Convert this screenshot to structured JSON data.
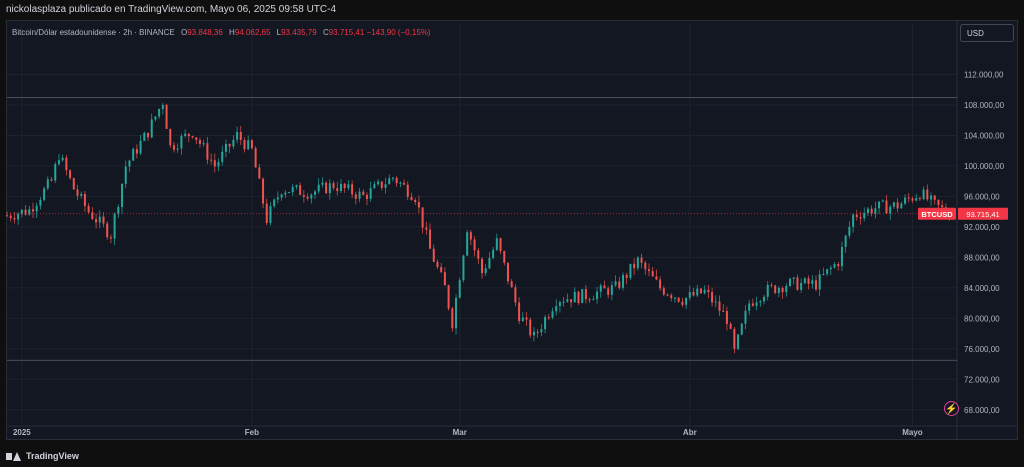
{
  "header": {
    "published": "nickolasplaza publicado en TradingView.com, Mayo 06, 2025 09:58 UTC-4"
  },
  "legend": {
    "title": "Bitcoin/Dólar estadounidense · 2h · BINANCE",
    "o_key": "O",
    "open": "93.848,36",
    "h_key": "H",
    "high": "94.062,65",
    "l_key": "L",
    "low": "93.435,79",
    "c_key": "C",
    "close": "93.715,41",
    "change": "−143,90 (−0,15%)"
  },
  "currency_button": "USD",
  "price_tag": {
    "symbol": "BTCUSD",
    "value": "93.715,41"
  },
  "footer": {
    "brand": "TradingView"
  },
  "colors": {
    "up": "#26a69a",
    "down": "#ef5350",
    "tag": "#f23645",
    "flash": "#e040a0"
  },
  "chart_data": {
    "type": "candlestick",
    "symbol": "BTCUSD",
    "interval": "2h",
    "exchange": "BINANCE",
    "ylim": [
      66000,
      116000
    ],
    "y_ticks": [
      "112.000,00",
      "108.000,00",
      "104.000,00",
      "100.000,00",
      "96.000,00",
      "92.000,00",
      "88.000,00",
      "84.000,00",
      "80.000,00",
      "76.000,00",
      "72.000,00",
      "68.000,00"
    ],
    "y_tick_values": [
      112000,
      108000,
      104000,
      100000,
      96000,
      92000,
      88000,
      84000,
      80000,
      76000,
      72000,
      68000
    ],
    "x_ticks": [
      "2025",
      "Feb",
      "Mar",
      "Abr",
      "Mayo"
    ],
    "x_tick_dates": [
      "2025-01-01",
      "2025-02-01",
      "2025-03-01",
      "2025-04-01",
      "2025-05-01"
    ],
    "x_range": [
      "2024-12-30",
      "2025-05-07"
    ],
    "last_price": 93715.41,
    "hlines": [
      109000,
      74500
    ],
    "closes": [
      {
        "date": "2024-12-30",
        "close": 93500
      },
      {
        "date": "2025-01-02",
        "close": 94200
      },
      {
        "date": "2025-01-05",
        "close": 98000
      },
      {
        "date": "2025-01-06",
        "close": 101500
      },
      {
        "date": "2025-01-08",
        "close": 97000
      },
      {
        "date": "2025-01-10",
        "close": 94000
      },
      {
        "date": "2025-01-13",
        "close": 91000
      },
      {
        "date": "2025-01-15",
        "close": 100000
      },
      {
        "date": "2025-01-18",
        "close": 104500
      },
      {
        "date": "2025-01-20",
        "close": 108500
      },
      {
        "date": "2025-01-21",
        "close": 102500
      },
      {
        "date": "2025-01-24",
        "close": 104500
      },
      {
        "date": "2025-01-27",
        "close": 100000
      },
      {
        "date": "2025-01-30",
        "close": 104000
      },
      {
        "date": "2025-02-01",
        "close": 102000
      },
      {
        "date": "2025-02-03",
        "close": 93000
      },
      {
        "date": "2025-02-05",
        "close": 97000
      },
      {
        "date": "2025-02-09",
        "close": 96500
      },
      {
        "date": "2025-02-12",
        "close": 97500
      },
      {
        "date": "2025-02-16",
        "close": 96000
      },
      {
        "date": "2025-02-20",
        "close": 98500
      },
      {
        "date": "2025-02-23",
        "close": 96000
      },
      {
        "date": "2025-02-25",
        "close": 89000
      },
      {
        "date": "2025-02-27",
        "close": 84000
      },
      {
        "date": "2025-02-28",
        "close": 79500
      },
      {
        "date": "2025-03-02",
        "close": 92000
      },
      {
        "date": "2025-03-04",
        "close": 86000
      },
      {
        "date": "2025-03-06",
        "close": 90000
      },
      {
        "date": "2025-03-09",
        "close": 80500
      },
      {
        "date": "2025-03-11",
        "close": 77500
      },
      {
        "date": "2025-03-14",
        "close": 82500
      },
      {
        "date": "2025-03-18",
        "close": 83000
      },
      {
        "date": "2025-03-22",
        "close": 84000
      },
      {
        "date": "2025-03-25",
        "close": 87500
      },
      {
        "date": "2025-03-28",
        "close": 84000
      },
      {
        "date": "2025-03-31",
        "close": 82500
      },
      {
        "date": "2025-04-03",
        "close": 83500
      },
      {
        "date": "2025-04-06",
        "close": 80000
      },
      {
        "date": "2025-04-07",
        "close": 75500
      },
      {
        "date": "2025-04-09",
        "close": 82000
      },
      {
        "date": "2025-04-11",
        "close": 83500
      },
      {
        "date": "2025-04-14",
        "close": 84500
      },
      {
        "date": "2025-04-18",
        "close": 84500
      },
      {
        "date": "2025-04-21",
        "close": 87500
      },
      {
        "date": "2025-04-23",
        "close": 93500
      },
      {
        "date": "2025-04-26",
        "close": 94500
      },
      {
        "date": "2025-04-29",
        "close": 94800
      },
      {
        "date": "2025-05-02",
        "close": 96500
      },
      {
        "date": "2025-05-04",
        "close": 94800
      },
      {
        "date": "2025-05-06",
        "close": 93715
      }
    ]
  }
}
